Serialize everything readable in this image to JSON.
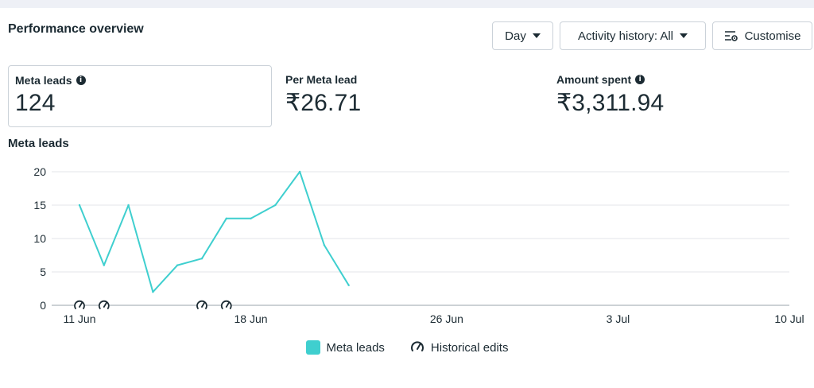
{
  "header": {
    "title": "Performance overview",
    "day_label": "Day",
    "activity_label": "Activity history: All",
    "customise_label": "Customise"
  },
  "metrics": [
    {
      "label": "Meta leads",
      "value": "124",
      "info": true,
      "selected": true
    },
    {
      "label": "Per Meta lead",
      "value": "₹26.71",
      "info": false,
      "selected": false
    },
    {
      "label": "Amount spent",
      "value": "₹3,311.94",
      "info": true,
      "selected": false
    }
  ],
  "chart_title": "Meta leads",
  "icons": {
    "info": "info-icon",
    "caret": "caret-down-icon",
    "customise": "customise-icon",
    "historical_edit": "historical-edit-icon"
  },
  "chart_data": {
    "type": "line",
    "title": "Meta leads",
    "x_ticks": [
      "11 Jun",
      "18 Jun",
      "26 Jun",
      "3 Jul",
      "10 Jul"
    ],
    "x_tick_days": [
      0,
      7,
      15,
      22,
      29
    ],
    "y_ticks": [
      0,
      5,
      10,
      15,
      20
    ],
    "ylim": [
      0,
      20
    ],
    "xlim_days": [
      0,
      29
    ],
    "grid": true,
    "series": [
      {
        "name": "Meta leads",
        "color": "#3fcfcf",
        "x_days": [
          0,
          1,
          2,
          3,
          4,
          5,
          6,
          7,
          8,
          9,
          10,
          11
        ],
        "values": [
          15,
          6,
          15,
          2,
          6,
          7,
          13,
          13,
          15,
          20,
          9,
          3
        ]
      }
    ],
    "historical_edits_days": [
      0,
      1,
      5,
      6
    ],
    "legend": [
      "Meta leads",
      "Historical edits"
    ],
    "legend_position": "bottom-center"
  }
}
